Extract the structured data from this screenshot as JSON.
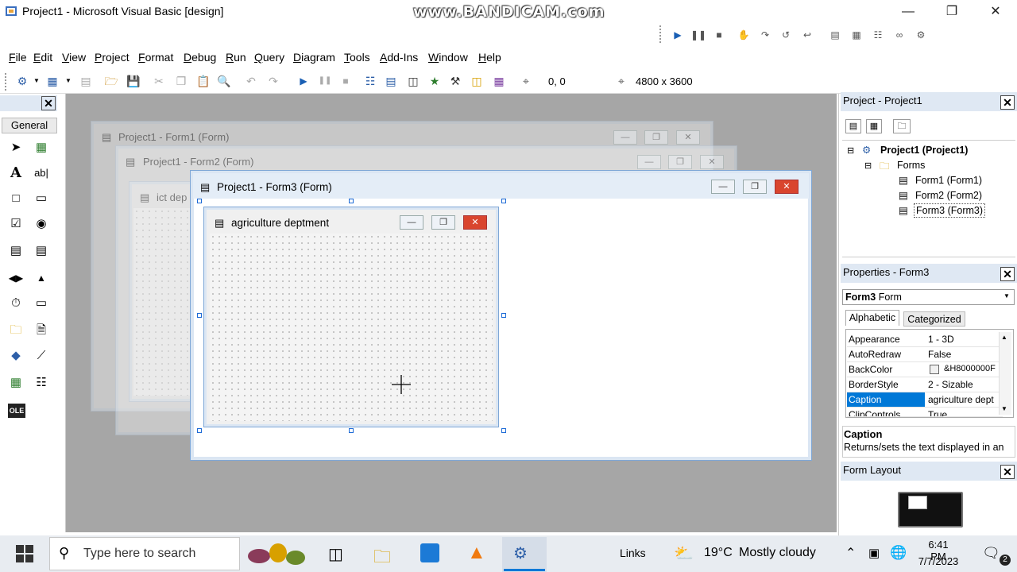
{
  "window": {
    "title": "Project1 - Microsoft Visual Basic [design]"
  },
  "watermark": "www.BANDICAM.com",
  "menu": [
    {
      "label": "File",
      "u": "F",
      "rest": "ile"
    },
    {
      "label": "Edit",
      "u": "E",
      "rest": "dit"
    },
    {
      "label": "View",
      "u": "V",
      "rest": "iew"
    },
    {
      "label": "Project",
      "u": "P",
      "rest": "roject"
    },
    {
      "label": "Format",
      "u": "F",
      "rest": "ormat"
    },
    {
      "label": "Debug",
      "u": "D",
      "rest": "ebug"
    },
    {
      "label": "Run",
      "u": "R",
      "rest": "un"
    },
    {
      "label": "Query",
      "u": "Q",
      "rest": "uery"
    },
    {
      "label": "Diagram",
      "u": "D",
      "rest": "iagram"
    },
    {
      "label": "Tools",
      "u": "T",
      "rest": "ools"
    },
    {
      "label": "Add-Ins",
      "u": "A",
      "rest": "dd-Ins"
    },
    {
      "label": "Window",
      "u": "W",
      "rest": "indow"
    },
    {
      "label": "Help",
      "u": "H",
      "rest": "elp"
    }
  ],
  "toolbar": {
    "position": "0, 0",
    "size": "4800 x 3600"
  },
  "toolbox": {
    "tab": "General",
    "ole_label": "OLE"
  },
  "forms": {
    "form1_title": "Project1 - Form1 (Form)",
    "form2_title": "Project1 - Form2 (Form)",
    "form2_inner_title": "ict dep",
    "form3_title": "Project1 - Form3 (Form)",
    "form3_inner_title": "agriculture deptment"
  },
  "project": {
    "title": "Project - Project1",
    "root": "Project1 (Project1)",
    "folder": "Forms",
    "items": [
      "Form1 (Form1)",
      "Form2 (Form2)",
      "Form3 (Form3)"
    ]
  },
  "properties": {
    "title": "Properties - Form3",
    "object_name": "Form3",
    "object_type": "Form",
    "tabs": [
      "Alphabetic",
      "Categorized"
    ],
    "rows": [
      {
        "name": "Appearance",
        "value": "1 - 3D"
      },
      {
        "name": "AutoRedraw",
        "value": "False"
      },
      {
        "name": "BackColor",
        "value": "&H8000000F"
      },
      {
        "name": "BorderStyle",
        "value": "2 - Sizable"
      },
      {
        "name": "Caption",
        "value": "agriculture dept"
      },
      {
        "name": "ClipControls",
        "value": "True"
      }
    ],
    "desc_title": "Caption",
    "desc_text": "Returns/sets the text displayed in an"
  },
  "form_layout": {
    "title": "Form Layout"
  },
  "taskbar": {
    "search_placeholder": "Type here to search",
    "links": "Links",
    "weather_temp": "19°C",
    "weather_desc": "Mostly cloudy",
    "time": "6:41 PM",
    "date": "7/7/2023",
    "notifications": "2"
  },
  "colors": {
    "accent": "#0078d7",
    "close_red": "#d9452e",
    "mdi_bg": "#a6a6a6",
    "selection": "#0078d7"
  }
}
